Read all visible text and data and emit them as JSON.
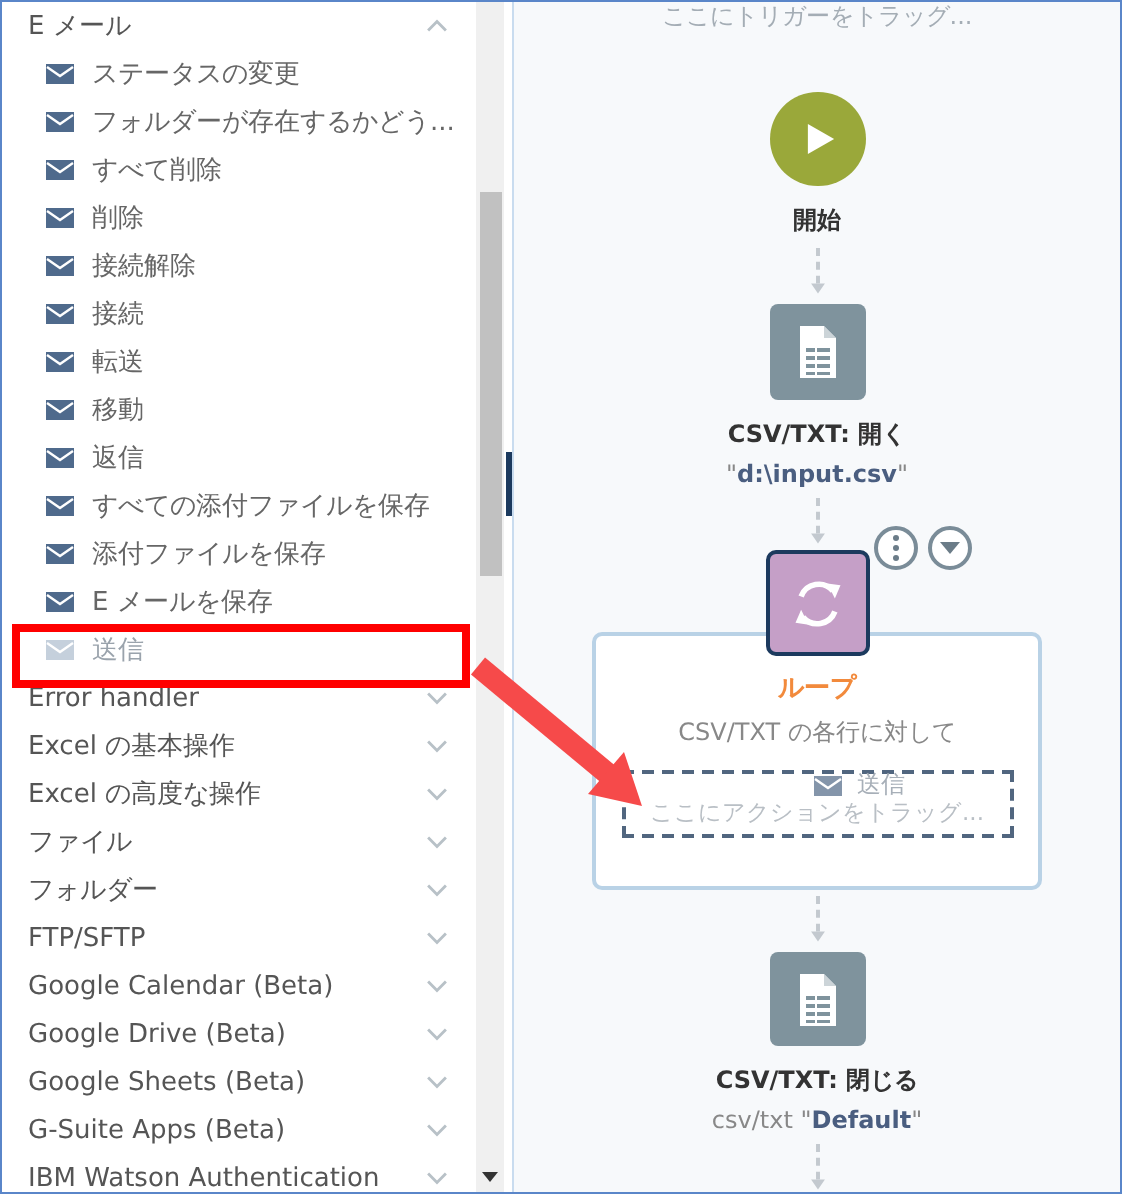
{
  "sidebar": {
    "groups": [
      {
        "label": "E メール",
        "expanded": true,
        "items": [
          {
            "label": "ステータスの変更",
            "disabled": false
          },
          {
            "label": "フォルダーが存在するかどう...",
            "disabled": false
          },
          {
            "label": "すべて削除",
            "disabled": false
          },
          {
            "label": "削除",
            "disabled": false
          },
          {
            "label": "接続解除",
            "disabled": false
          },
          {
            "label": "接続",
            "disabled": false
          },
          {
            "label": "転送",
            "disabled": false
          },
          {
            "label": "移動",
            "disabled": false
          },
          {
            "label": "返信",
            "disabled": false
          },
          {
            "label": "すべての添付ファイルを保存",
            "disabled": false
          },
          {
            "label": "添付ファイルを保存",
            "disabled": false
          },
          {
            "label": "E メールを保存",
            "disabled": false
          },
          {
            "label": "送信",
            "disabled": true
          }
        ]
      },
      {
        "label": "Error handler",
        "expanded": false
      },
      {
        "label": "Excel の基本操作",
        "expanded": false
      },
      {
        "label": "Excel の高度な操作",
        "expanded": false
      },
      {
        "label": "ファイル",
        "expanded": false
      },
      {
        "label": "フォルダー",
        "expanded": false
      },
      {
        "label": "FTP/SFTP",
        "expanded": false
      },
      {
        "label": "Google Calendar (Beta)",
        "expanded": false
      },
      {
        "label": "Google Drive (Beta)",
        "expanded": false
      },
      {
        "label": "Google Sheets (Beta)",
        "expanded": false
      },
      {
        "label": "G-Suite Apps (Beta)",
        "expanded": false
      },
      {
        "label": "IBM Watson Authentication",
        "expanded": false
      }
    ]
  },
  "canvas": {
    "trigger_placeholder": "ここにトリガーをトラッグ...",
    "steps": [
      {
        "kind": "start",
        "title": "開始",
        "selected": false
      },
      {
        "kind": "action",
        "title": "CSV/TXT: 開く",
        "subtitle": "\"**d:\\input.csv**\"",
        "selected": false
      },
      {
        "kind": "loop",
        "title": "ループ",
        "subtitle": "CSV/TXT の各行に対して",
        "selected": true,
        "drop_zone": {
          "placeholder": "ここにアクションをトラッグ...",
          "dragged_item": "送信"
        }
      },
      {
        "kind": "action",
        "title": "CSV/TXT: 閉じる",
        "subtitle": "csv/txt \"**Default**\"",
        "selected": false
      }
    ]
  }
}
